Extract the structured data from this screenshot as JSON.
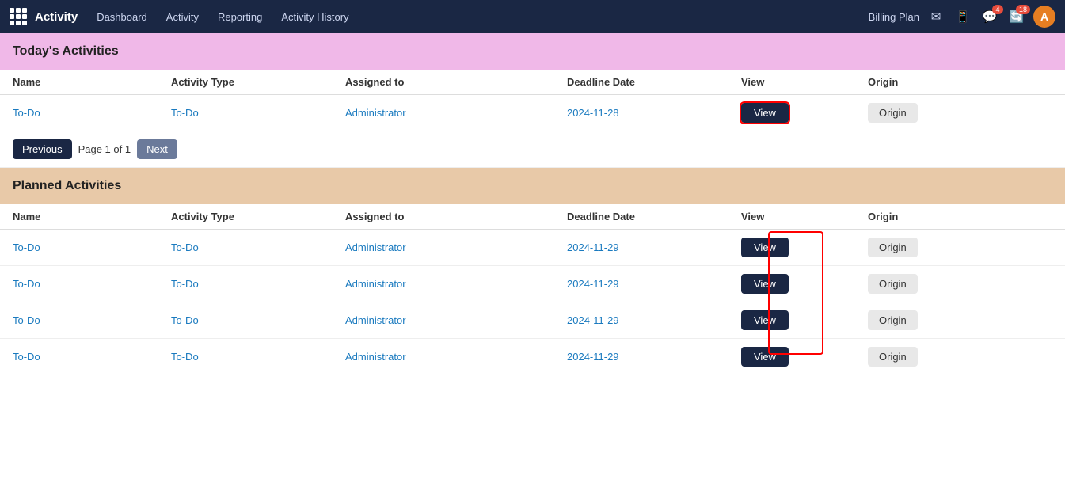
{
  "app": {
    "brand": "Activity",
    "nav_links": [
      "Dashboard",
      "Activity",
      "Reporting",
      "Activity History"
    ],
    "billing_label": "Billing Plan",
    "user_avatar": "A"
  },
  "icons": {
    "chat_badge": "4",
    "refresh_badge": "18"
  },
  "today_section": {
    "title": "Today's Activities",
    "columns": [
      "Name",
      "Activity Type",
      "Assigned to",
      "Deadline Date",
      "View",
      "Origin"
    ],
    "rows": [
      {
        "name": "To-Do",
        "activity_type": "To-Do",
        "assigned_to": "Administrator",
        "deadline_date": "2024-11-28",
        "view_label": "View",
        "origin_label": "Origin"
      }
    ],
    "pagination": {
      "prev_label": "Previous",
      "page_info": "Page 1 of 1",
      "next_label": "Next"
    }
  },
  "planned_section": {
    "title": "Planned Activities",
    "columns": [
      "Name",
      "Activity Type",
      "Assigned to",
      "Deadline Date",
      "View",
      "Origin"
    ],
    "rows": [
      {
        "name": "To-Do",
        "activity_type": "To-Do",
        "assigned_to": "Administrator",
        "deadline_date": "2024-11-29",
        "view_label": "View",
        "origin_label": "Origin"
      },
      {
        "name": "To-Do",
        "activity_type": "To-Do",
        "assigned_to": "Administrator",
        "deadline_date": "2024-11-29",
        "view_label": "View",
        "origin_label": "Origin"
      },
      {
        "name": "To-Do",
        "activity_type": "To-Do",
        "assigned_to": "Administrator",
        "deadline_date": "2024-11-29",
        "view_label": "View",
        "origin_label": "Origin"
      },
      {
        "name": "To-Do",
        "activity_type": "To-Do",
        "assigned_to": "Administrator",
        "deadline_date": "2024-11-29",
        "view_label": "View",
        "origin_label": "Origin"
      }
    ]
  }
}
